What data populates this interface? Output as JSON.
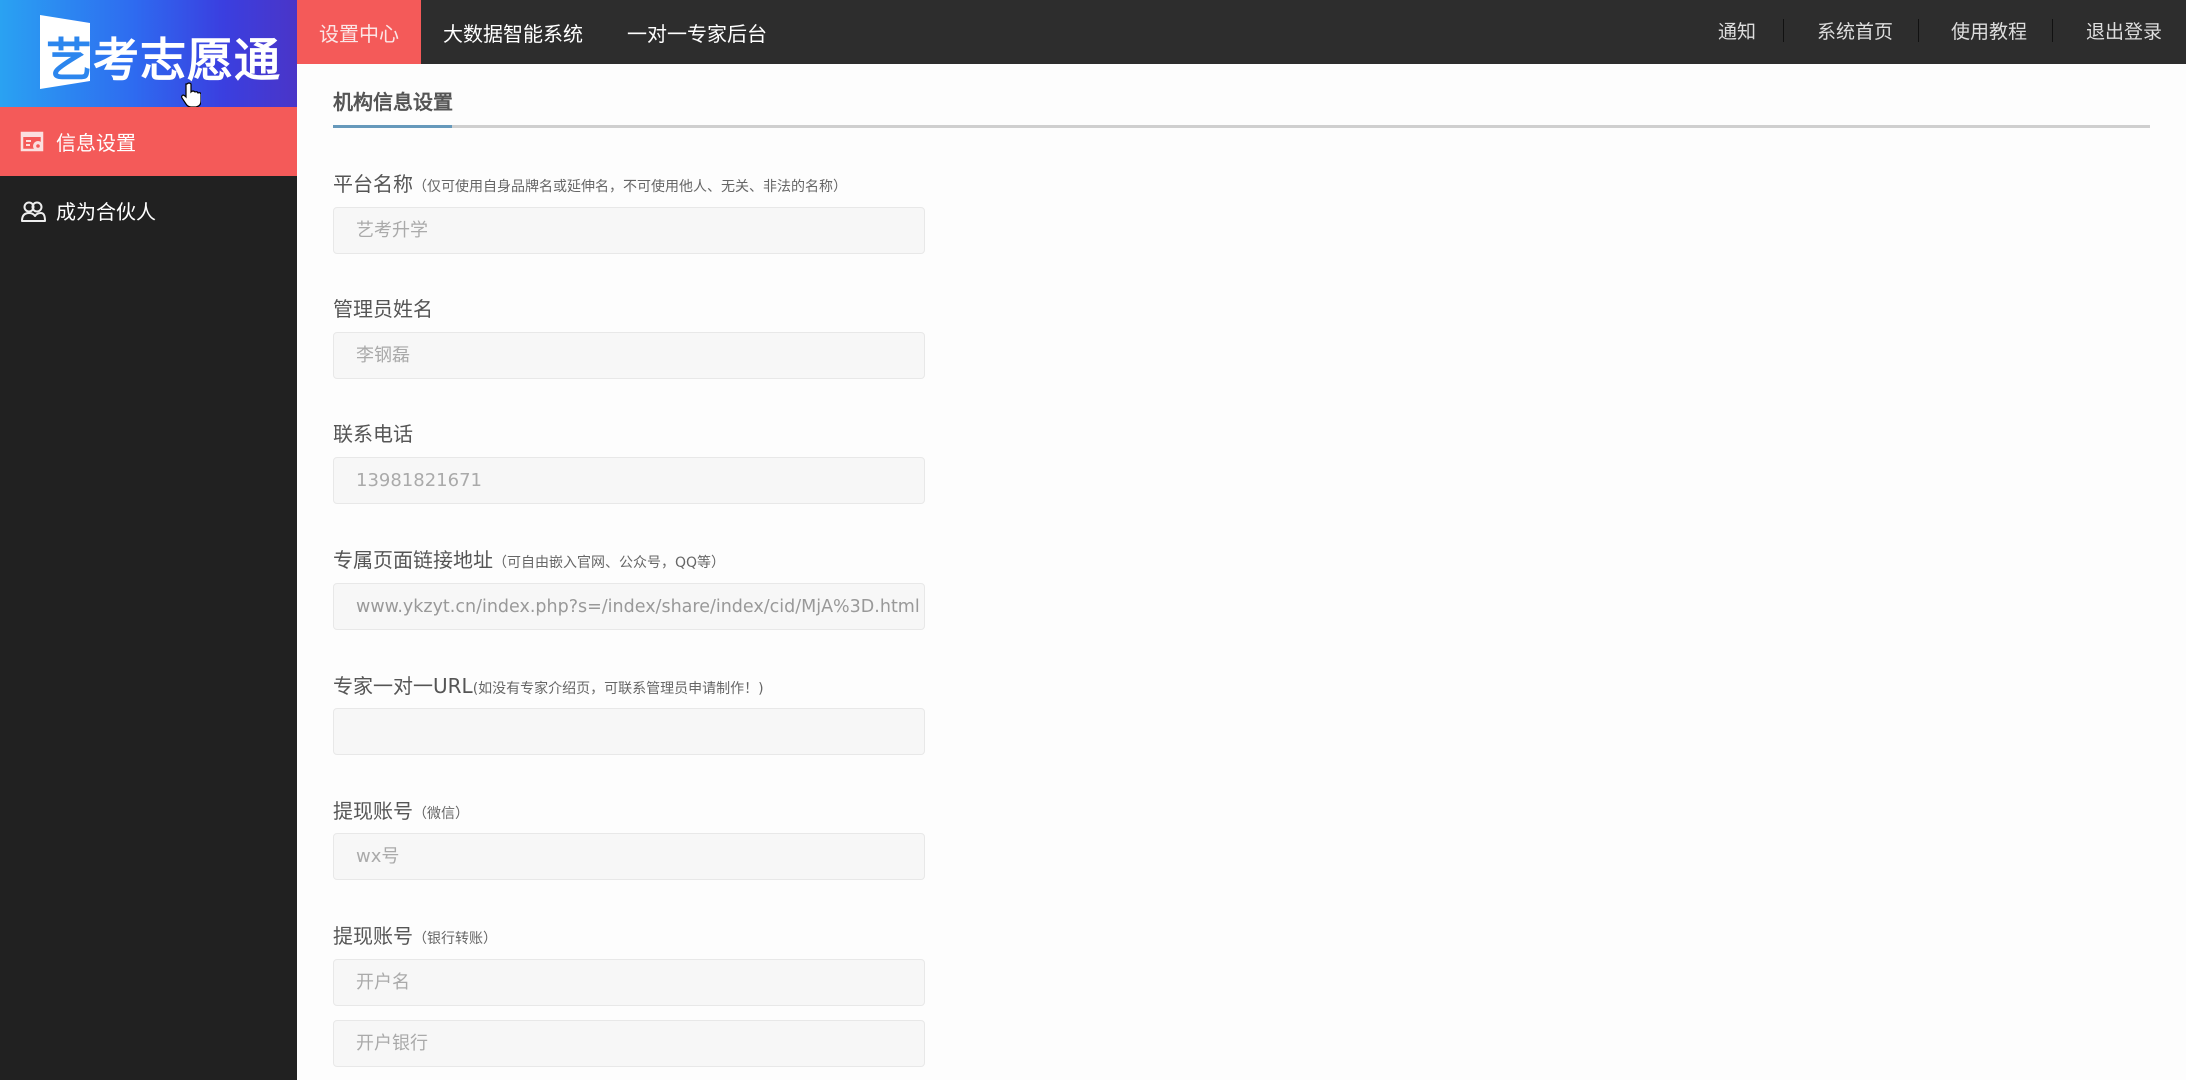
{
  "brand": {
    "logo_first_char": "艺",
    "logo_rest": "考志愿通",
    "gradient_colors": [
      "#2aa2f2",
      "#2e6bf0",
      "#4a35c8"
    ]
  },
  "sidebar": {
    "items": [
      {
        "label": "信息设置",
        "icon": "settings-card-icon",
        "active": true
      },
      {
        "label": "成为合伙人",
        "icon": "users-icon",
        "active": false
      }
    ]
  },
  "topbar": {
    "tabs": [
      {
        "label": "设置中心",
        "active": true
      },
      {
        "label": "大数据智能系统",
        "active": false
      },
      {
        "label": "一对一专家后台",
        "active": false
      }
    ],
    "links": [
      {
        "label": "通知"
      },
      {
        "label": "系统首页"
      },
      {
        "label": "使用教程"
      },
      {
        "label": "退出登录"
      }
    ]
  },
  "colors": {
    "accent_red": "#f45a59",
    "sidebar_bg": "#212121",
    "topbar_bg": "#2d2d2d",
    "underline_accent": "#6699bb"
  },
  "form": {
    "title": "机构信息设置",
    "fields": [
      {
        "label": "平台名称",
        "hint": "（仅可使用自身品牌名或延伸名，不可使用他人、无关、非法的名称）",
        "value": "",
        "placeholder": "艺考升学"
      },
      {
        "label": "管理员姓名",
        "hint": "",
        "value": "",
        "placeholder": "李钢磊"
      },
      {
        "label": "联系电话",
        "hint": "",
        "value": "",
        "placeholder": "13981821671"
      },
      {
        "label": "专属页面链接地址",
        "hint": "（可自由嵌入官网、公众号，QQ等）",
        "value": "www.ykzyt.cn/index.php?s=/index/share/index/cid/MjA%3D.html",
        "placeholder": ""
      },
      {
        "label": "专家一对一URL",
        "hint": "(如没有专家介绍页，可联系管理员申请制作！)",
        "value": "",
        "placeholder": ""
      },
      {
        "label": "提现账号",
        "hint": "（微信）",
        "value": "",
        "placeholder": "wx号"
      },
      {
        "label": "提现账号",
        "hint": "（银行转账）",
        "value": "",
        "placeholder": "开户名"
      }
    ],
    "extra_input": {
      "value": "",
      "placeholder": "开户银行"
    }
  }
}
